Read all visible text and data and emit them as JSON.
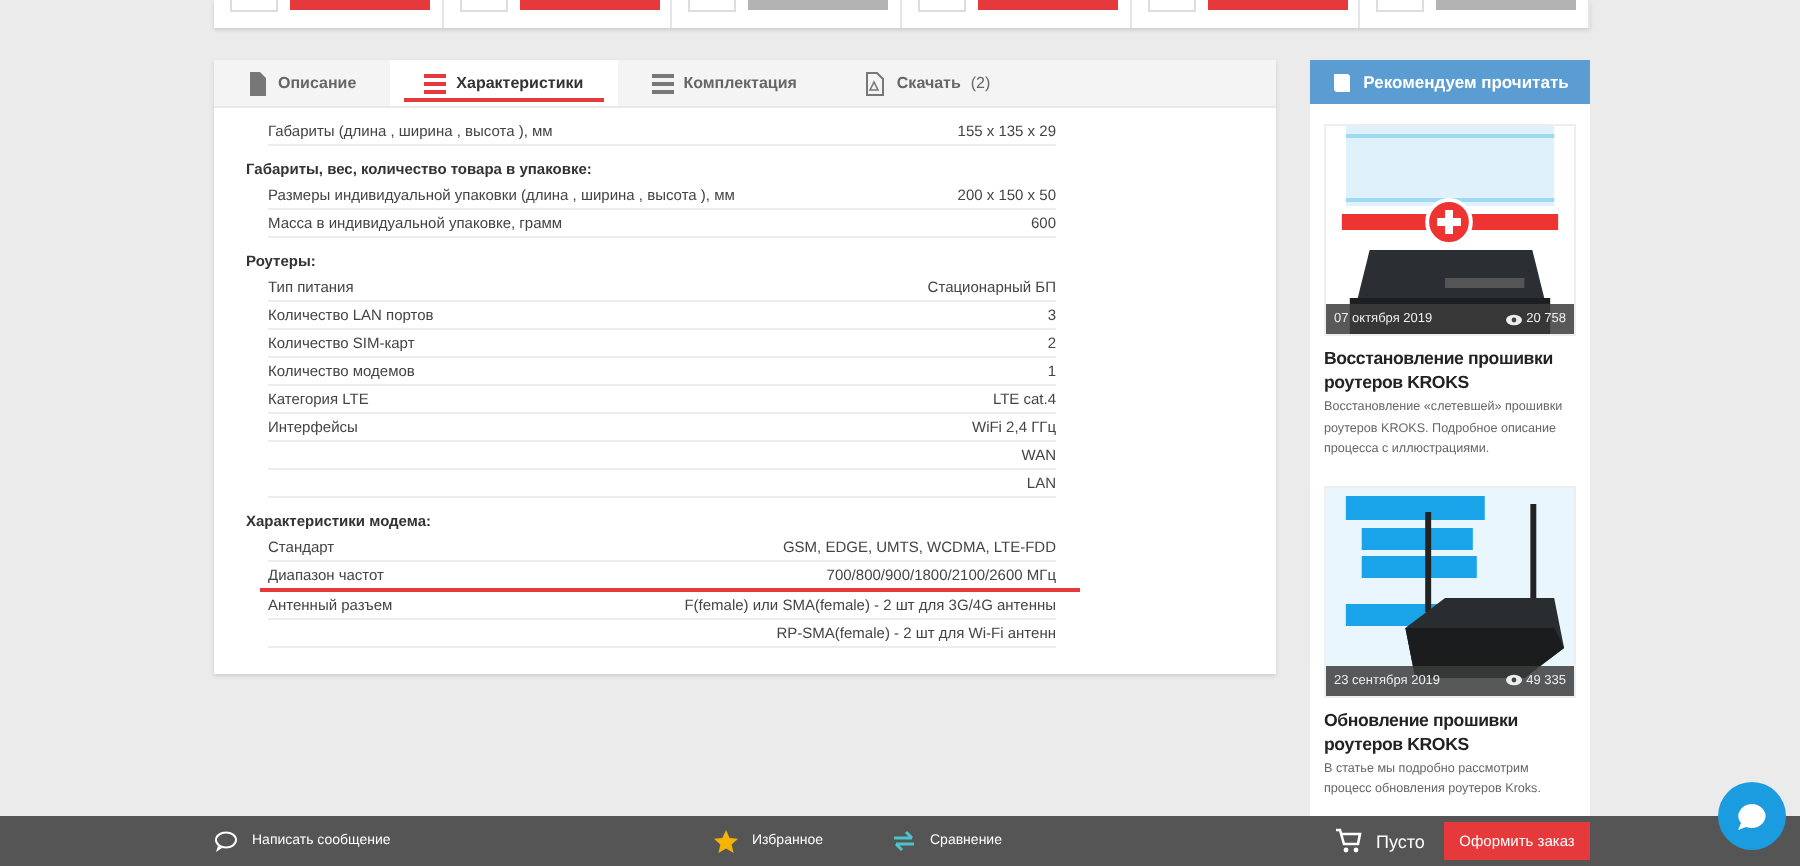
{
  "top_cards": [
    {
      "disabled": false
    },
    {
      "disabled": false
    },
    {
      "disabled": true
    },
    {
      "disabled": false
    },
    {
      "disabled": false
    },
    {
      "disabled": true
    }
  ],
  "tabs": [
    {
      "label": "Описание",
      "kind": "doc",
      "selected": false
    },
    {
      "label": "Характеристики",
      "kind": "list",
      "selected": true
    },
    {
      "label": "Комплектация",
      "kind": "list",
      "selected": false
    },
    {
      "label": "Скачать",
      "kind": "pdf",
      "count": "(2)",
      "selected": false
    }
  ],
  "spec_sections": [
    {
      "rows": [
        {
          "label": "Габариты (длина , ширина , высота ), мм",
          "value": "155  x  135  x  29",
          "highlighted": false
        }
      ]
    },
    {
      "heading": "Габариты, вес, количество товара в упаковке:",
      "rows": [
        {
          "label": "Размеры индивидуальной упаковки (длина , ширина , высота ), мм",
          "value": "200  x  150  x  50",
          "highlighted": false
        },
        {
          "label": "Масса в индивидуальной упаковке, грамм",
          "value": "600",
          "highlighted": false
        }
      ]
    },
    {
      "heading": "Роутеры:",
      "rows": [
        {
          "label": "Тип питания",
          "value": "Стационарный БП",
          "highlighted": false
        },
        {
          "label": "Количество LAN портов",
          "value": "3",
          "highlighted": false
        },
        {
          "label": "Количество SIM-карт",
          "value": "2",
          "highlighted": false
        },
        {
          "label": "Количество модемов",
          "value": "1",
          "highlighted": false
        },
        {
          "label": "Категория LTE",
          "value": "LTE cat.4",
          "highlighted": false
        },
        {
          "label": "Интерфейсы",
          "value": "WiFi 2,4 ГГц",
          "highlighted": false
        },
        {
          "value": "WAN",
          "highlighted": false
        },
        {
          "value": "LAN",
          "highlighted": false
        }
      ]
    },
    {
      "heading": "Характеристики модема:",
      "rows": [
        {
          "label": "Стандарт",
          "value": "GSM, EDGE, UMTS, WCDMA, LTE-FDD",
          "highlighted": false
        },
        {
          "label": "Диапазон частот",
          "value": "700/800/900/1800/2100/2600 МГц",
          "highlighted": true
        },
        {
          "label": "Антенный разъем",
          "value": "F(female) или SMA(female) - 2 шт для 3G/4G антенны",
          "highlighted": false
        },
        {
          "value": "RP-SMA(female) - 2 шт для Wi-Fi антенн",
          "highlighted": false
        }
      ]
    }
  ],
  "sidebar": {
    "title": "Рекомендуем прочитать",
    "articles": [
      {
        "date": "07 октября 2019",
        "views": "20 758",
        "title": "Восстановление прошивки роутеров KROKS",
        "summary": "Восстановление «слетевшей» прошивки роутеров KROKS. Подробное описание процесса с иллюстрациями."
      },
      {
        "date": "23 сентября 2019",
        "views": "49 335",
        "title": "Обновление прошивки роутеров KROKS",
        "summary": "В статье мы подробно рассмотрим процесс обновления роутеров Kroks."
      }
    ]
  },
  "bottom_bar": {
    "message": "Написать сообщение",
    "favorites": "Избранное",
    "compare": "Сравнение",
    "cart": "Пусто",
    "checkout": "Оформить заказ"
  }
}
